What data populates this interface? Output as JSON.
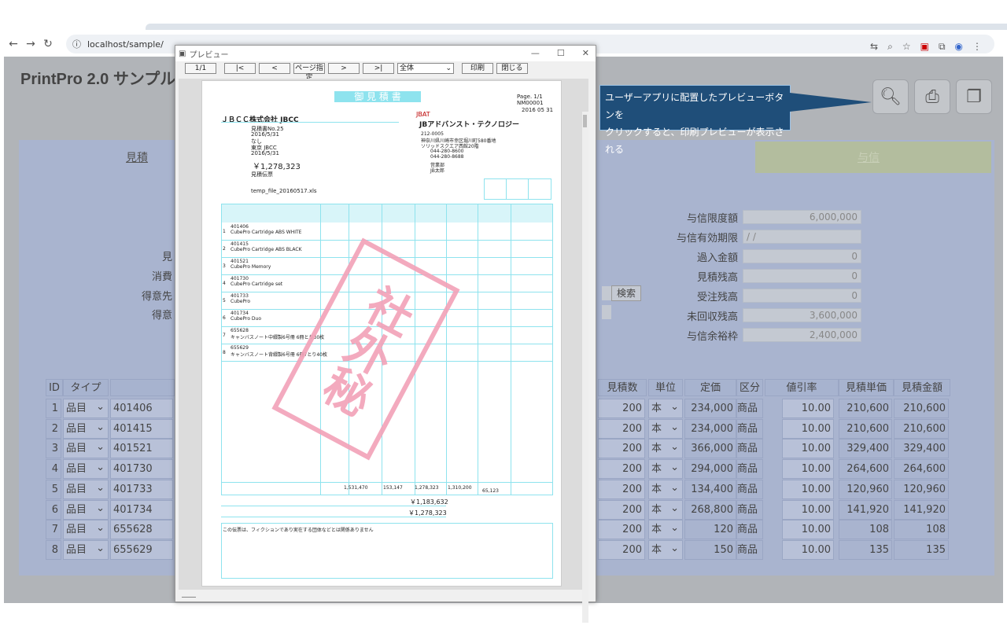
{
  "browser": {
    "url": "localhost/sample/"
  },
  "app": {
    "title": "PrintPro 2.0 サンプル",
    "tab_estimate": "見積",
    "tab_right": "与信"
  },
  "left_labels": [
    "見",
    "消費",
    "得意先",
    "得意"
  ],
  "search_button": "検索",
  "credit_fields": [
    {
      "label": "与信限度額",
      "value": "6,000,000"
    },
    {
      "label": "与信有効期限",
      "value": "/ /"
    },
    {
      "label": "過入金額",
      "value": "0"
    },
    {
      "label": "見積残高",
      "value": "0"
    },
    {
      "label": "受注残高",
      "value": "0"
    },
    {
      "label": "未回収残高",
      "value": "3,600,000"
    },
    {
      "label": "与信余裕枠",
      "value": "2,400,000"
    }
  ],
  "table": {
    "headers": [
      "ID",
      "タイプ",
      "見積数",
      "単位",
      "定価",
      "区分",
      "値引率",
      "見積単価",
      "見積金額"
    ],
    "rows": [
      {
        "id": "1",
        "type": "品目",
        "code": "401406",
        "qty": "200",
        "unit": "本",
        "price": "234,000",
        "cls": "商品",
        "disc": "10.00",
        "up": "210,600",
        "amt": "210,600"
      },
      {
        "id": "2",
        "type": "品目",
        "code": "401415",
        "qty": "200",
        "unit": "本",
        "price": "234,000",
        "cls": "商品",
        "disc": "10.00",
        "up": "210,600",
        "amt": "210,600"
      },
      {
        "id": "3",
        "type": "品目",
        "code": "401521",
        "qty": "200",
        "unit": "本",
        "price": "366,000",
        "cls": "商品",
        "disc": "10.00",
        "up": "329,400",
        "amt": "329,400"
      },
      {
        "id": "4",
        "type": "品目",
        "code": "401730",
        "qty": "200",
        "unit": "本",
        "price": "294,000",
        "cls": "商品",
        "disc": "10.00",
        "up": "264,600",
        "amt": "264,600"
      },
      {
        "id": "5",
        "type": "品目",
        "code": "401733",
        "qty": "200",
        "unit": "本",
        "price": "134,400",
        "cls": "商品",
        "disc": "10.00",
        "up": "120,960",
        "amt": "120,960"
      },
      {
        "id": "6",
        "type": "品目",
        "code": "401734",
        "qty": "200",
        "unit": "本",
        "price": "268,800",
        "cls": "商品",
        "disc": "10.00",
        "up": "141,920",
        "amt": "141,920"
      },
      {
        "id": "7",
        "type": "品目",
        "code": "655628",
        "qty": "200",
        "unit": "本",
        "price": "120",
        "cls": "商品",
        "disc": "10.00",
        "up": "108",
        "amt": "108"
      },
      {
        "id": "8",
        "type": "品目",
        "code": "655629",
        "qty": "200",
        "unit": "本",
        "price": "150",
        "cls": "商品",
        "disc": "10.00",
        "up": "135",
        "amt": "135"
      }
    ]
  },
  "preview": {
    "title": "プレビュー",
    "page_indicator": "1/1",
    "btn_first": "|<",
    "btn_prev": "<",
    "btn_page": "ページ指定",
    "btn_next": ">",
    "btn_last": ">|",
    "zoom": "全体",
    "btn_print": "印刷",
    "btn_close": "閉じる",
    "doc": {
      "heading": "御 見 積 書",
      "page": "Page. 1/1",
      "estno": "NM00001",
      "date": "2016  05  31",
      "customer": "ＪＢＣＣ株式会社 JBCC",
      "fields": [
        "見積書No.25",
        "2016/5/31",
        "なし",
        "東京 JBCC",
        "2016/5/31"
      ],
      "amount": "￥1,278,323",
      "note_label": "見積伝票",
      "file": "temp_file_20160517.xls",
      "company_logo": "JBAT",
      "company": "JBアドバンスト・テクノロジー",
      "addr": [
        "212-0005",
        "神奈川県川崎市幸区堀川町580番地",
        "ソリッドスクエア西館20階",
        "044-280-8600",
        "044-280-8688",
        "営業部",
        "JB太郎"
      ],
      "items": [
        {
          "code": "401406",
          "name": "CubePro Cartridge ABS WHITE"
        },
        {
          "code": "401415",
          "name": "CubePro Cartridge ABS BLACK"
        },
        {
          "code": "401521",
          "name": "CubePro Memory"
        },
        {
          "code": "401730",
          "name": "CubePro Cartridge set"
        },
        {
          "code": "401733",
          "name": "CubePro"
        },
        {
          "code": "401734",
          "name": "CubePro Duo"
        },
        {
          "code": "655628",
          "name": "キャンバスノート中綴製6号冊 6冊とり30枚"
        },
        {
          "code": "655629",
          "name": "キャンバスノート背綴製6号冊 6冊7とり40枚"
        }
      ],
      "totals": [
        "1,531,470",
        "153,147",
        "1,278,323",
        "1,310,200",
        "65,123"
      ],
      "tax_total": "￥1,183,632",
      "grand_total": "￥1,278,323",
      "remark": "この伝票は、フィクションであり実在する団体などとは関係ありません",
      "stamp": "社外秘"
    }
  },
  "callout": {
    "line1": "ユーザーアプリに配置したプレビューボタンを",
    "line2": "クリックすると、印刷プレビューが表示される"
  }
}
